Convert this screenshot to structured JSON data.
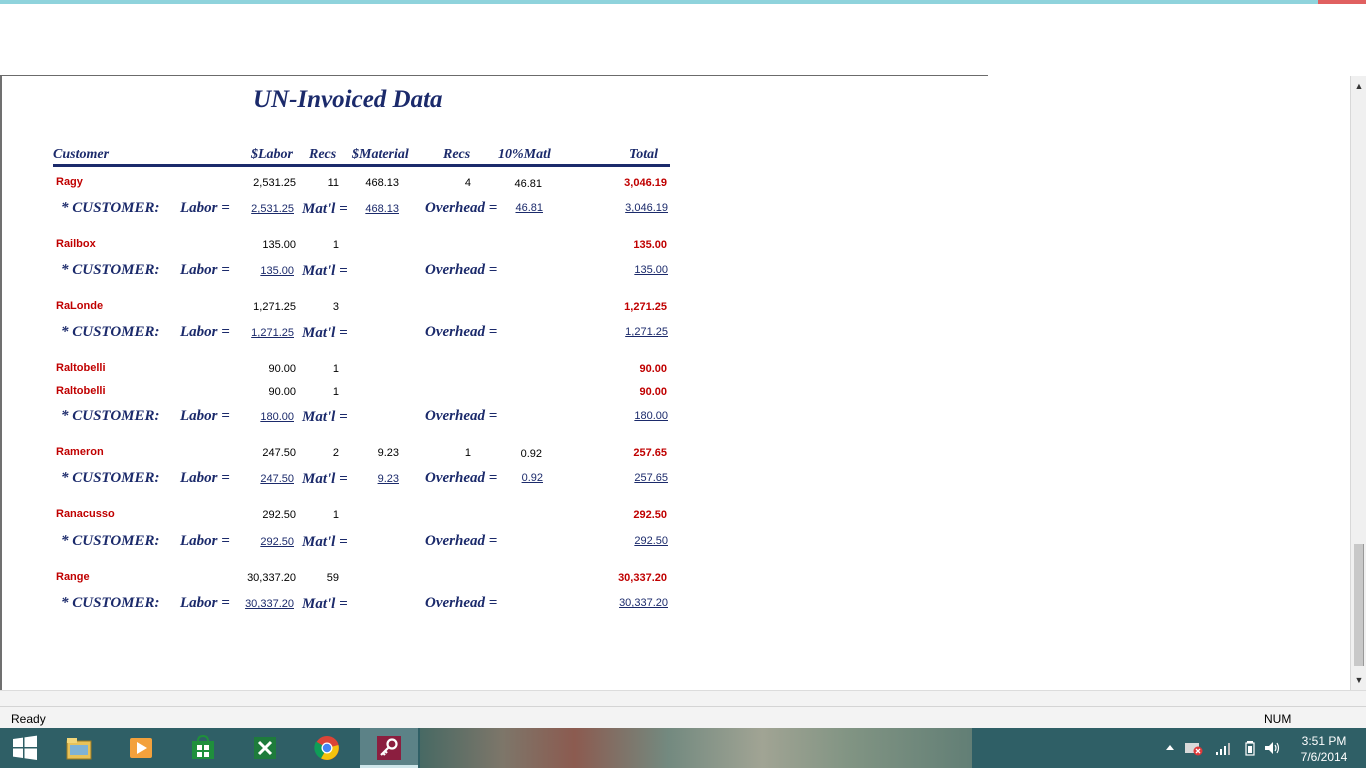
{
  "report": {
    "title": "UN-Invoiced Data",
    "headers": {
      "customer": "Customer",
      "labor": "$Labor",
      "recs1": "Recs",
      "material": "$Material",
      "recs2": "Recs",
      "matl10": "10%Matl",
      "total": "Total"
    },
    "summary_labels": {
      "customer": "* CUSTOMER:",
      "labor": "Labor =",
      "matl": "Mat'l =",
      "overhead": "Overhead ="
    },
    "details": [
      {
        "name": "Ragy",
        "labor": "2,531.25",
        "recs": "11",
        "material": "468.13",
        "recs2": "4",
        "matl10": "46.81",
        "total": "3,046.19"
      },
      {
        "name": "Railbox",
        "labor": "135.00",
        "recs": "1",
        "material": "",
        "recs2": "",
        "matl10": "",
        "total": "135.00"
      },
      {
        "name": "RaLonde",
        "labor": "1,271.25",
        "recs": "3",
        "material": "",
        "recs2": "",
        "matl10": "",
        "total": "1,271.25"
      },
      {
        "name": "Raltobelli",
        "labor": "90.00",
        "recs": "1",
        "material": "",
        "recs2": "",
        "matl10": "",
        "total": "90.00"
      },
      {
        "name": "Raltobelli",
        "labor": "90.00",
        "recs": "1",
        "material": "",
        "recs2": "",
        "matl10": "",
        "total": "90.00"
      },
      {
        "name": "Rameron",
        "labor": "247.50",
        "recs": "2",
        "material": "9.23",
        "recs2": "1",
        "matl10": "0.92",
        "total": "257.65"
      },
      {
        "name": "Ranacusso",
        "labor": "292.50",
        "recs": "1",
        "material": "",
        "recs2": "",
        "matl10": "",
        "total": "292.50"
      },
      {
        "name": "Range",
        "labor": "30,337.20",
        "recs": "59",
        "material": "",
        "recs2": "",
        "matl10": "",
        "total": "30,337.20"
      }
    ],
    "summaries": [
      {
        "labor": "2,531.25",
        "matl": "468.13",
        "overhead": "46.81",
        "total": "3,046.19"
      },
      {
        "labor": "135.00",
        "matl": "",
        "overhead": "",
        "total": "135.00"
      },
      {
        "labor": "1,271.25",
        "matl": "",
        "overhead": "",
        "total": "1,271.25"
      },
      {
        "labor": "180.00",
        "matl": "",
        "overhead": "",
        "total": "180.00"
      },
      {
        "labor": "247.50",
        "matl": "9.23",
        "overhead": "0.92",
        "total": "257.65"
      },
      {
        "labor": "292.50",
        "matl": "",
        "overhead": "",
        "total": "292.50"
      },
      {
        "labor": "30,337.20",
        "matl": "",
        "overhead": "",
        "total": "30,337.20"
      }
    ]
  },
  "statusbar": {
    "left": "Ready",
    "right": "NUM"
  },
  "taskbar": {
    "apps": [
      {
        "icon": "windows-start-icon"
      },
      {
        "icon": "file-explorer-icon"
      },
      {
        "icon": "media-player-icon"
      },
      {
        "icon": "store-icon"
      },
      {
        "icon": "excel-icon"
      },
      {
        "icon": "chrome-icon"
      },
      {
        "icon": "access-key-icon"
      }
    ],
    "time": "3:51 PM",
    "date": "7/6/2014"
  },
  "colors": {
    "accent": "#1b2a6b",
    "customer_red": "#c00000",
    "taskbar": "#2f5f66"
  }
}
